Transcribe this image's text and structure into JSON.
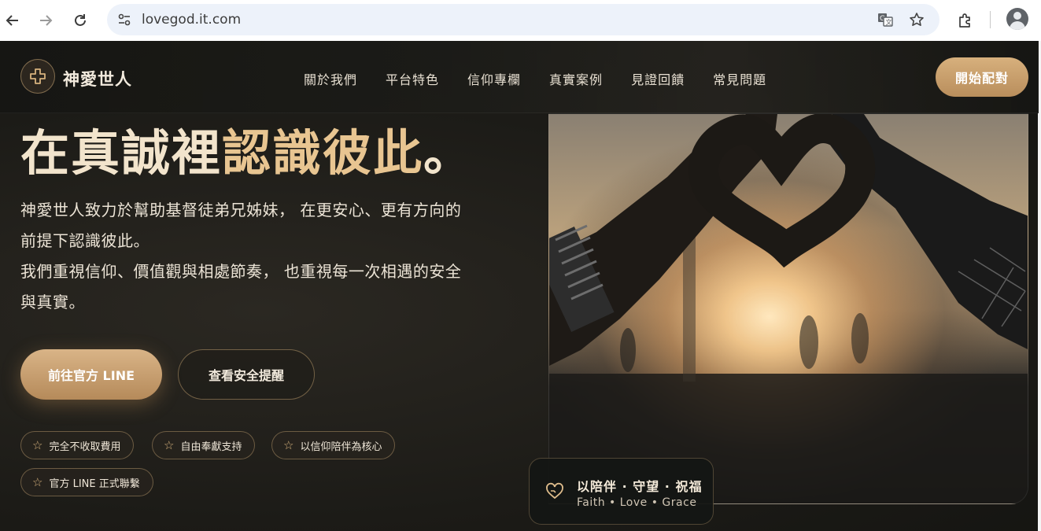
{
  "browser": {
    "url": "lovegod.it.com",
    "back_icon": "back-arrow-icon",
    "forward_icon": "forward-arrow-icon",
    "reload_icon": "reload-icon"
  },
  "header": {
    "brand": "神愛世人",
    "nav": [
      "關於我們",
      "平台特色",
      "信仰專欄",
      "真實案例",
      "見證回饋",
      "常見問題"
    ],
    "cta": "開始配對"
  },
  "hero": {
    "title_part1": "在真誠裡",
    "title_part2": "認識彼此",
    "title_punct": "。",
    "desc": [
      "神愛世人致力於幫助基督徒弟兄姊妹， 在更安心、更有方向的",
      "前提下認識彼此。",
      "我們重視信仰、價值觀與相處節奏， 也重視每一次相遇的安全",
      "與真實。"
    ],
    "primary_button": "前往官方 LINE",
    "secondary_button": "查看安全提醒",
    "tags": [
      "完全不收取費用",
      "自由奉獻支持",
      "以信仰陪伴為核心",
      "官方 LINE 正式聯繫"
    ]
  },
  "badge": {
    "main": "以陪伴 · 守望 · 祝福",
    "sub": "Faith • Love • Grace",
    "icon": "heart-hand-icon"
  },
  "colors": {
    "accent_gold": "#d6b27d",
    "background_dark": "#1c1b17"
  }
}
